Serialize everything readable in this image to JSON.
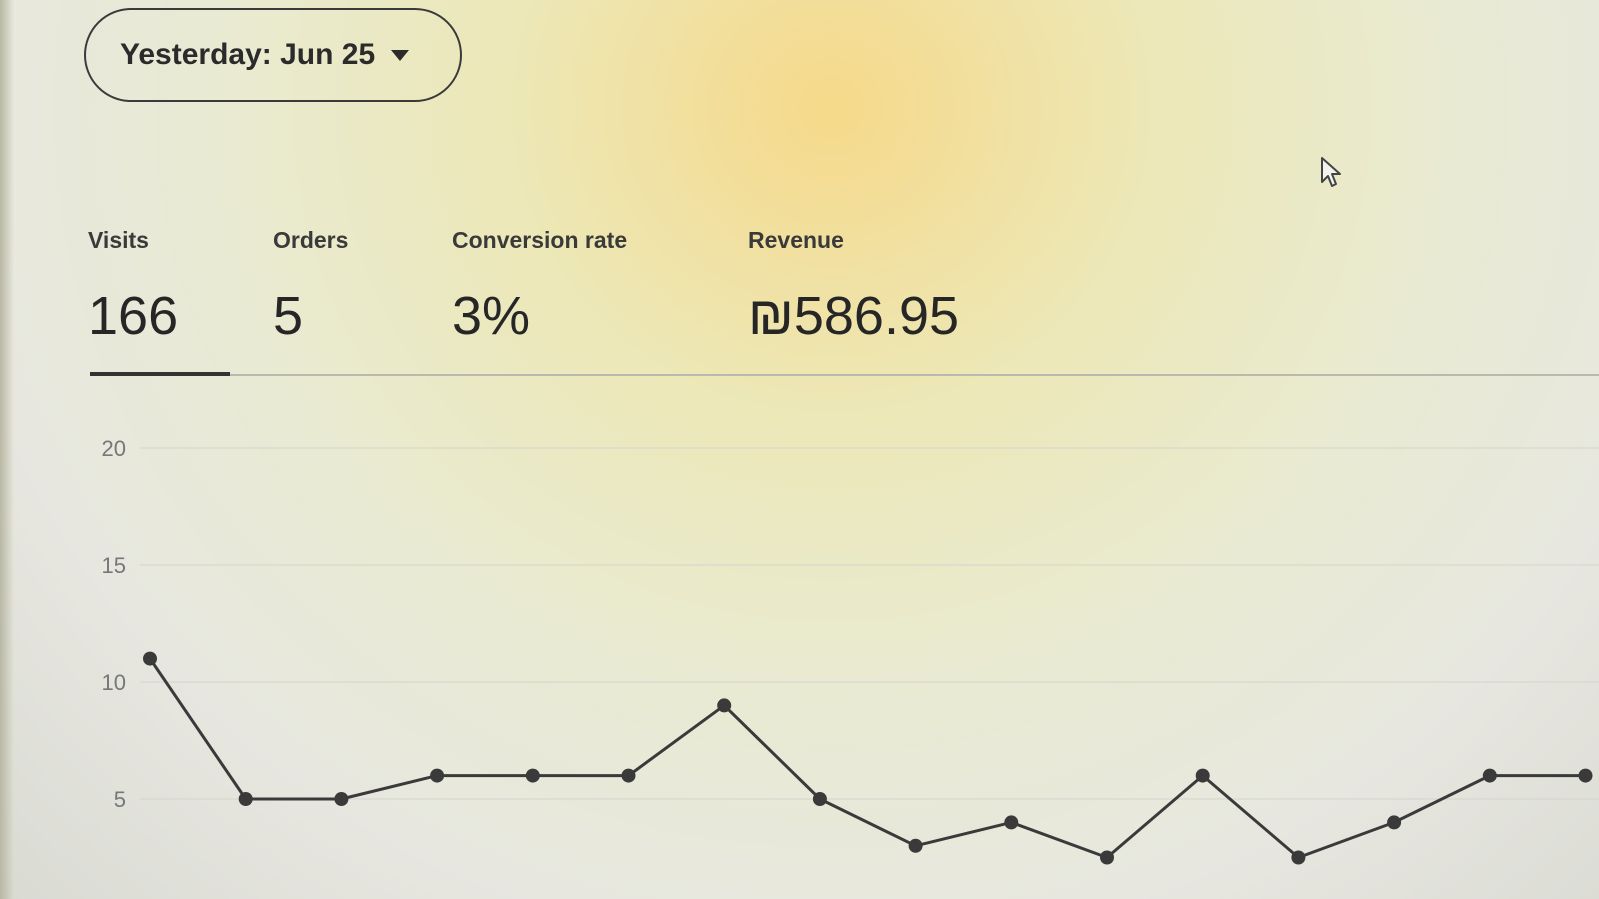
{
  "date_picker": {
    "label": "Yesterday: Jun 25",
    "icon": "caret-down-icon"
  },
  "metrics": [
    {
      "label": "Visits",
      "value": "166",
      "active": true
    },
    {
      "label": "Orders",
      "value": "5",
      "active": false
    },
    {
      "label": "Conversion rate",
      "value": "3%",
      "active": false
    },
    {
      "label": "Revenue",
      "value": "₪586.95",
      "active": false
    }
  ],
  "chart_data": {
    "type": "line",
    "y_ticks": [
      "20",
      "15",
      "10",
      "5"
    ],
    "ylim": [
      0,
      20
    ],
    "grid": true,
    "values": [
      11,
      5,
      5,
      6,
      6,
      6,
      9,
      5,
      3,
      4,
      2.5,
      6,
      2.5,
      4,
      6,
      6
    ]
  },
  "colors": {
    "line": "#3a3a3a",
    "grid": "#d4d4cc",
    "text": "#222222"
  }
}
